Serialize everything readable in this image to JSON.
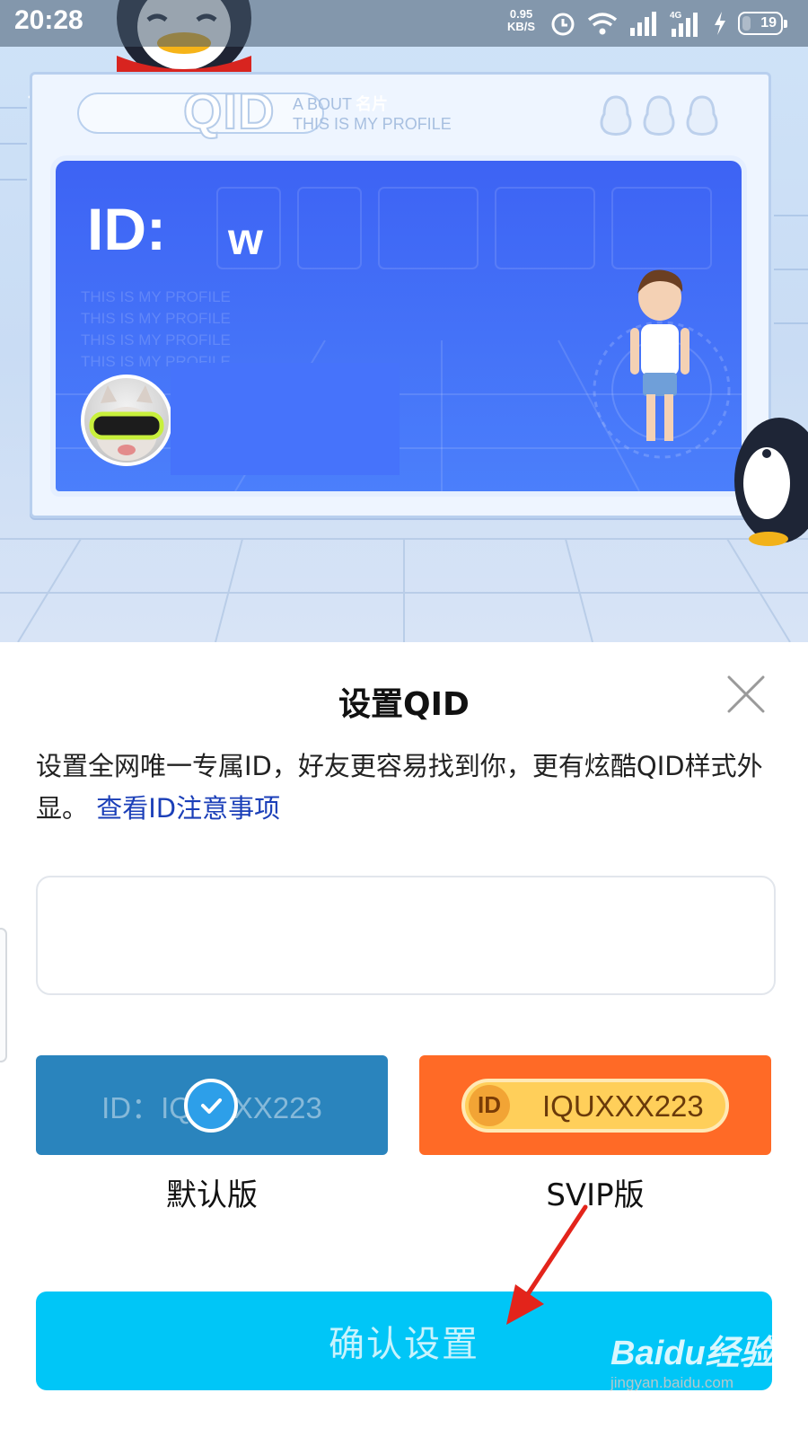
{
  "status_bar": {
    "time": "20:28",
    "net_speed_value": "0.95",
    "net_speed_unit": "KB/S",
    "network_type": "4G",
    "battery": "19"
  },
  "card": {
    "header_title": "QID",
    "header_sub_line1": "A BOUT",
    "header_sub_line2": "THIS IS MY PROFILE",
    "overlay_title": "名片",
    "id_label": "ID:",
    "id_value": "w",
    "profile_lines": [
      "THIS IS MY PROFILE",
      "THIS IS MY PROFILE",
      "THIS IS MY PROFILE",
      "THIS IS MY PROFILE"
    ]
  },
  "sheet": {
    "title": "设置QID",
    "description": "设置全网唯一专属ID，好友更容易找到你，更有炫酷QID样式外显。",
    "description_link": "查看ID注意事项",
    "input_value": "",
    "options": {
      "default": {
        "preview_text": "ID：IQUXXX223",
        "caption": "默认版",
        "selected": true
      },
      "svip": {
        "badge": "ID",
        "preview_text": "IQUXXX223",
        "caption": "SVIP版",
        "selected": false
      }
    },
    "confirm_label": "确认设置"
  },
  "watermark": {
    "main": "Baidu经验",
    "sub": "jingyan.baidu.com"
  },
  "colors": {
    "card_blue": "#4270f7",
    "default_option": "#2a84bd",
    "svip_option": "#ff6a26",
    "confirm_button": "#00c6f7",
    "link": "#1b3fb8",
    "annotation_arrow": "#e3241b"
  }
}
